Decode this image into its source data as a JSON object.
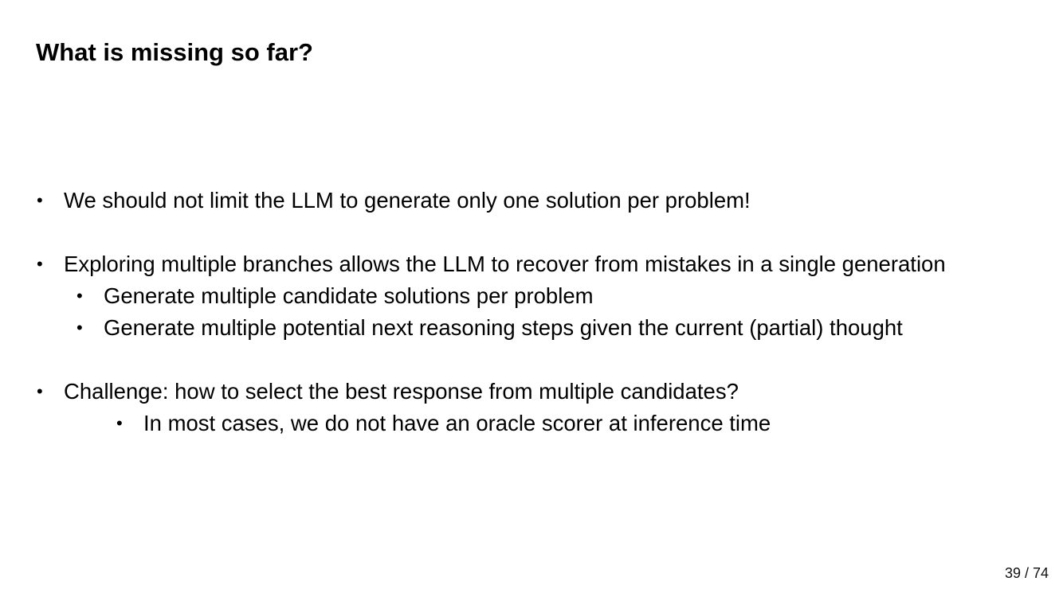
{
  "slide": {
    "title": "What is missing so far?",
    "bullet_glyph": "•",
    "bullets": [
      {
        "text": "We should not limit the LLM to generate only one solution per problem!"
      },
      {
        "text": "Exploring multiple branches allows the LLM to recover from mistakes in a single generation"
      },
      {
        "text": "Generate multiple candidate solutions per problem"
      },
      {
        "text": "Generate multiple potential next reasoning steps given the current (partial) thought"
      },
      {
        "text": "Challenge: how to select the best response from multiple candidates?"
      },
      {
        "text": "In most cases, we do not have an oracle scorer at inference time"
      }
    ]
  },
  "footer": {
    "page_number": "39 / 74"
  }
}
